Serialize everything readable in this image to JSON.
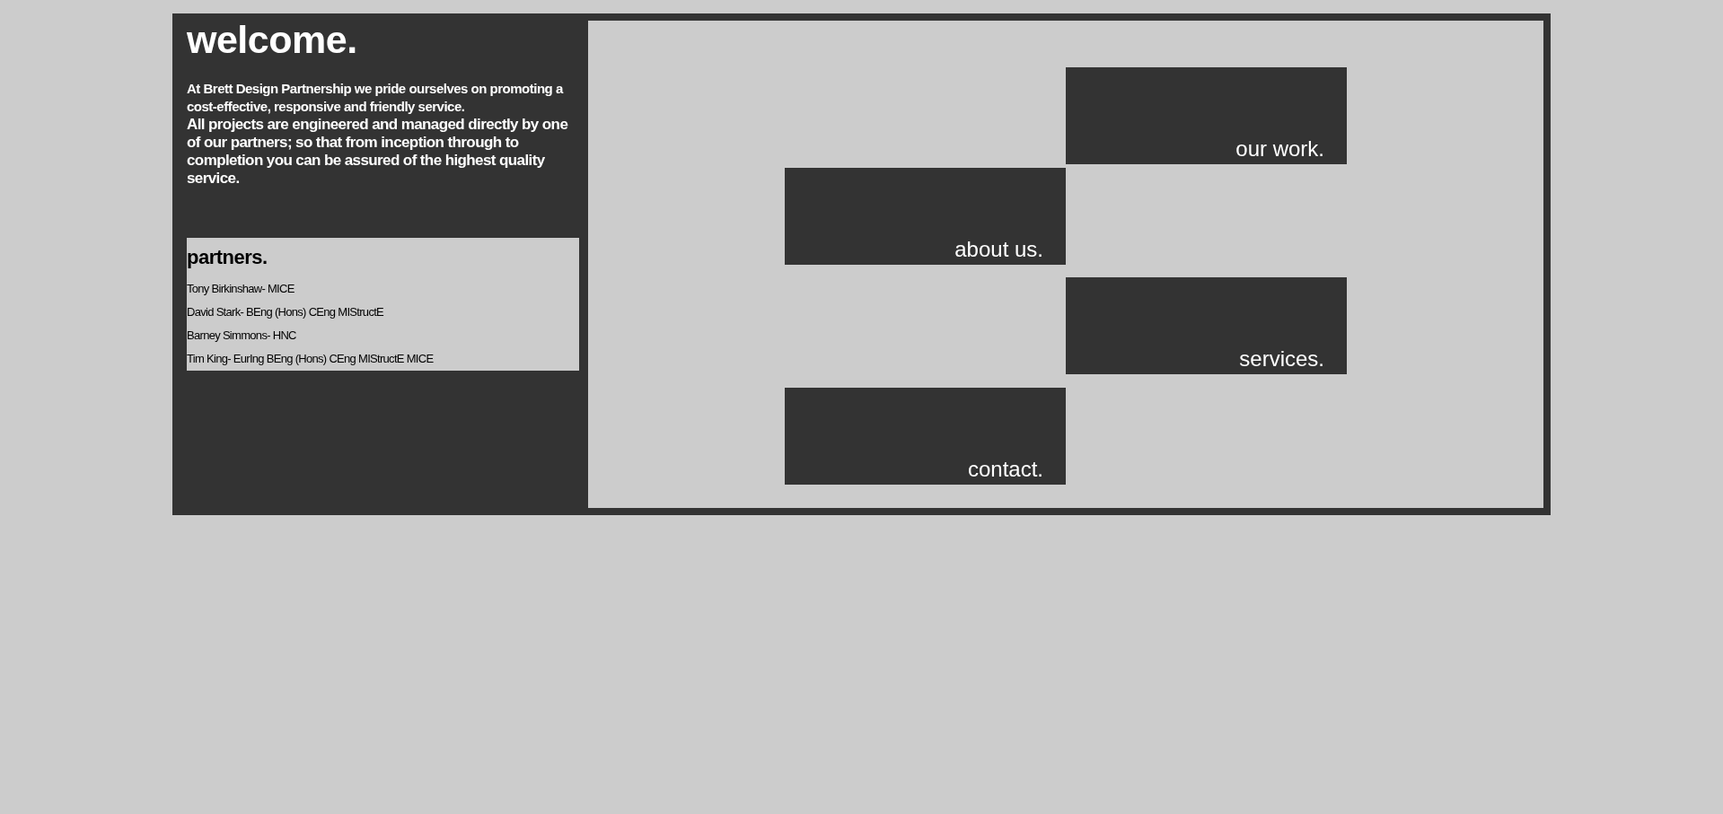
{
  "welcome": {
    "heading": "welcome.",
    "paragraphs": [
      "At Brett Design Partnership we pride ourselves on promoting a cost-effective, responsive and friendly service.",
      "All projects are engineered and managed directly by one of our partners; so that from inception through to completion you can be assured of the highest quality service."
    ]
  },
  "partners": {
    "heading": "partners.",
    "members": [
      "Tony Birkinshaw- MICE",
      "David Stark- BEng (Hons) CEng MIStructE",
      "Barney Simmons- HNC",
      "Tim King- EurIng BEng (Hons) CEng MIStructE MICE"
    ]
  },
  "nav_tiles": [
    {
      "label": "our work."
    },
    {
      "label": "about us."
    },
    {
      "label": "services."
    },
    {
      "label": "contact."
    }
  ]
}
